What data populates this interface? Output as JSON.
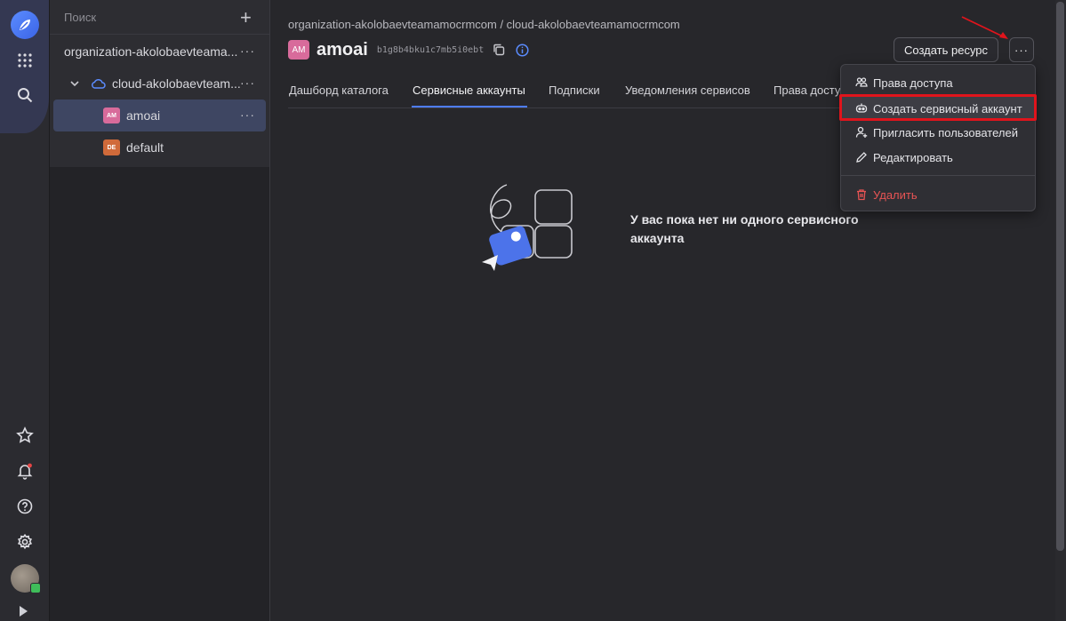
{
  "sidebar_tree": {
    "search_placeholder": "Поиск",
    "add_label": "+",
    "items": [
      {
        "label": "organization-akolobaevteama...",
        "more": "···"
      },
      {
        "label": "cloud-akolobaevteam...",
        "more": "···"
      },
      {
        "label": "amoai",
        "tag": "AM",
        "more": "···"
      },
      {
        "label": "default",
        "tag": "DE"
      }
    ]
  },
  "header": {
    "breadcrumb": "organization-akolobaevteamamocrmcom / cloud-akolobaevteamamocrmcom",
    "title_tag": "AM",
    "title": "amoai",
    "folder_id": "b1g8b4bku1c7mb5i0ebt",
    "create_resource_label": "Создать ресурс",
    "more_label": "···"
  },
  "tabs": [
    {
      "label": "Дашборд каталога",
      "active": false
    },
    {
      "label": "Сервисные аккаунты",
      "active": true
    },
    {
      "label": "Подписки",
      "active": false
    },
    {
      "label": "Уведомления сервисов",
      "active": false
    },
    {
      "label": "Права досту",
      "active": false
    }
  ],
  "empty_state": {
    "message": "У вас пока нет ни одного сервисного аккаунта"
  },
  "menu": {
    "items": [
      {
        "label": "Права доступа",
        "icon": "people-icon"
      },
      {
        "label": "Создать сервисный аккаунт",
        "icon": "robot-icon",
        "highlighted": true
      },
      {
        "label": "Пригласить пользователей",
        "icon": "user-plus-icon"
      },
      {
        "label": "Редактировать",
        "icon": "pencil-icon"
      },
      {
        "label": "Удалить",
        "icon": "trash-icon",
        "danger": true
      }
    ]
  },
  "colors": {
    "accent": "#4e7dff",
    "highlight_border": "#e0141c",
    "danger": "#e85454",
    "tag_am": "#d86b9b",
    "tag_de": "#d06a3a"
  }
}
